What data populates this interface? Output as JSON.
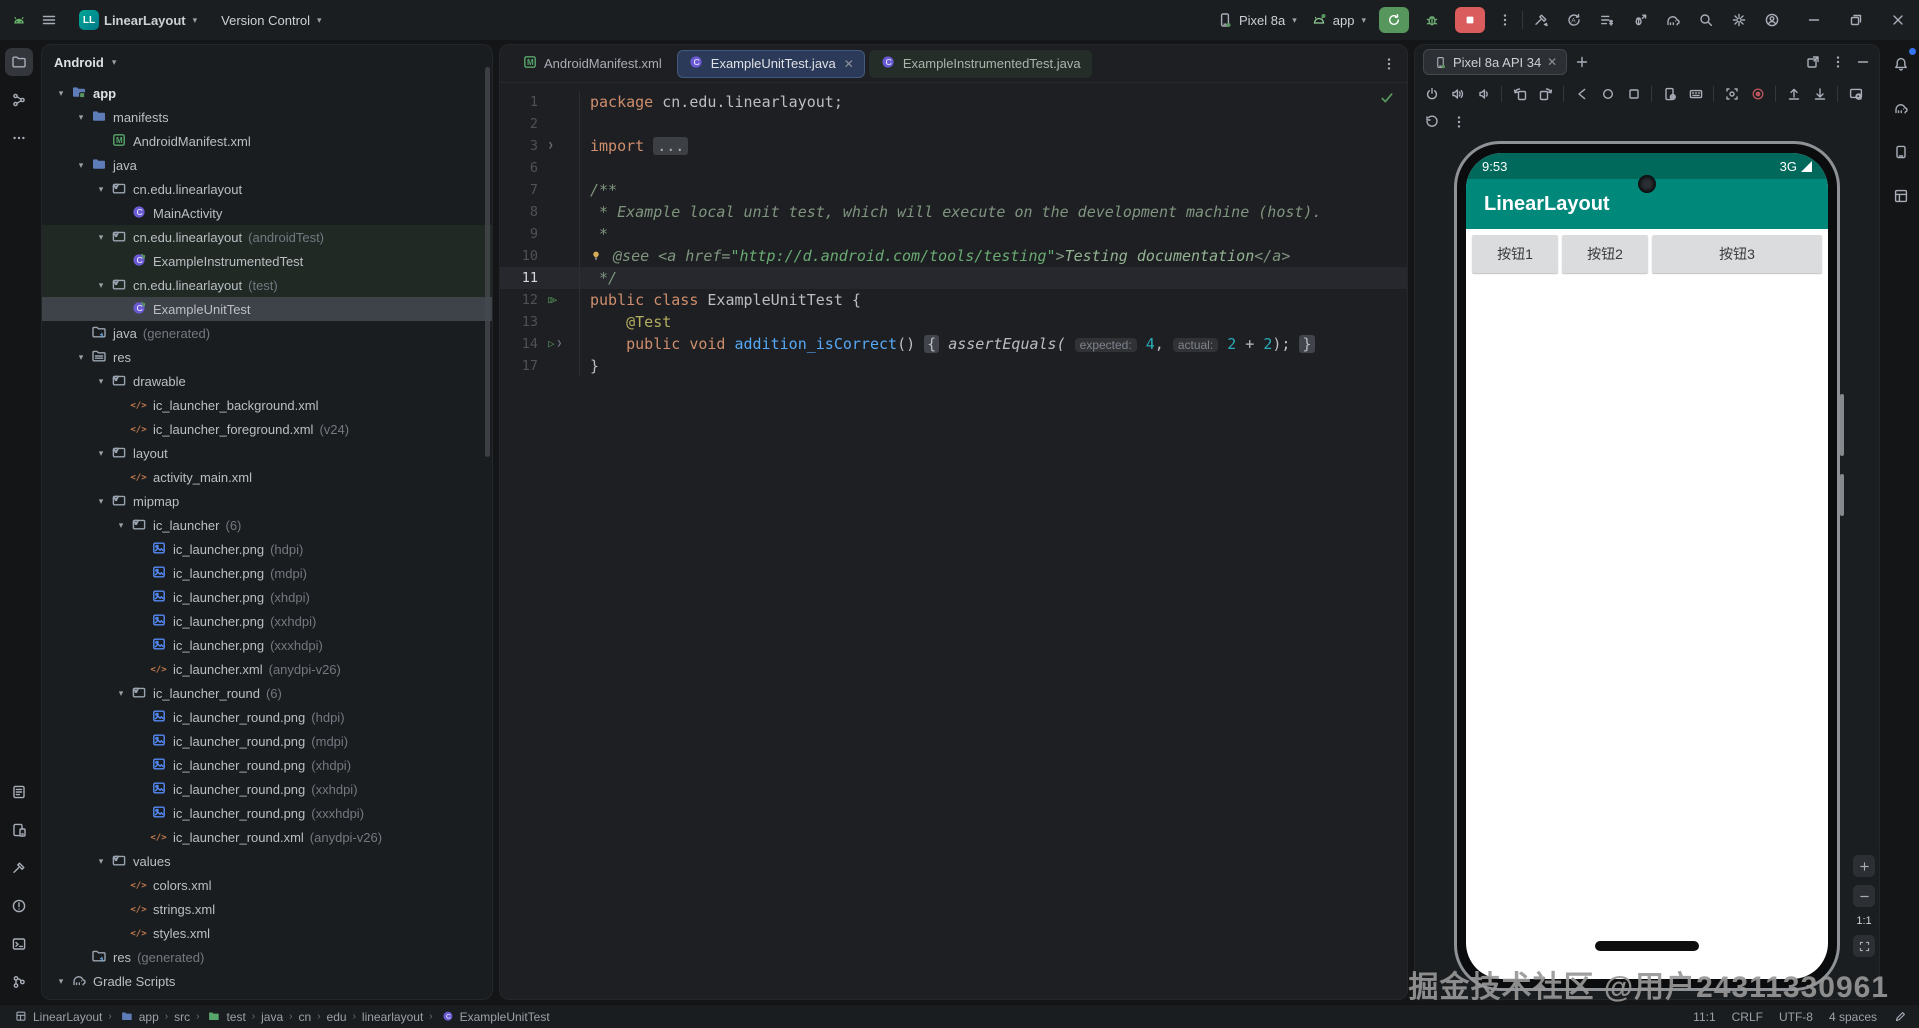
{
  "titlebar": {
    "project_badge": "LL",
    "project_name": "LinearLayout",
    "vcs_label": "Version Control",
    "device_name": "Pixel 8a",
    "run_config": "app",
    "left_icons": [
      "android-logo",
      "hamburger"
    ],
    "right_icons": [
      "build-hammer",
      "sync-a",
      "profiler-list",
      "attach-debug",
      "gradle-sync",
      "search",
      "settings",
      "account"
    ]
  },
  "left_strip": {
    "top": [
      "project",
      "structure",
      "more"
    ],
    "bottom": [
      "logcat",
      "device-manager",
      "build",
      "problems",
      "terminal",
      "version-control"
    ]
  },
  "project_panel": {
    "header": "Android",
    "tree": [
      {
        "i": 0,
        "ic": "folder-app",
        "t": "app",
        "m": "",
        "ch": 1,
        "b": 1
      },
      {
        "i": 1,
        "ic": "folder",
        "t": "manifests",
        "ch": 1
      },
      {
        "i": 2,
        "ic": "manifest",
        "t": "AndroidManifest.xml"
      },
      {
        "i": 1,
        "ic": "folder",
        "t": "java",
        "ch": 1
      },
      {
        "i": 2,
        "ic": "package",
        "t": "cn.edu.linearlayout",
        "ch": 1
      },
      {
        "i": 3,
        "ic": "class",
        "t": "MainActivity"
      },
      {
        "i": 2,
        "ic": "package",
        "t": "cn.edu.linearlayout",
        "m": "(androidTest)",
        "ch": 1,
        "tint": 1
      },
      {
        "i": 3,
        "ic": "testclass",
        "t": "ExampleInstrumentedTest",
        "tint": 1
      },
      {
        "i": 2,
        "ic": "package",
        "t": "cn.edu.linearlayout",
        "m": "(test)",
        "ch": 1,
        "tint": 1
      },
      {
        "i": 3,
        "ic": "testclass",
        "t": "ExampleUnitTest",
        "tint": 1,
        "sel": 1
      },
      {
        "i": 1,
        "ic": "folder-gen",
        "t": "java",
        "m": "(generated)"
      },
      {
        "i": 1,
        "ic": "folder-res",
        "t": "res",
        "ch": 1
      },
      {
        "i": 2,
        "ic": "package",
        "t": "drawable",
        "ch": 1
      },
      {
        "i": 3,
        "ic": "xml",
        "t": "ic_launcher_background.xml"
      },
      {
        "i": 3,
        "ic": "xml",
        "t": "ic_launcher_foreground.xml",
        "m": "(v24)"
      },
      {
        "i": 2,
        "ic": "package",
        "t": "layout",
        "ch": 1
      },
      {
        "i": 3,
        "ic": "xml",
        "t": "activity_main.xml"
      },
      {
        "i": 2,
        "ic": "package",
        "t": "mipmap",
        "ch": 1
      },
      {
        "i": 3,
        "ic": "package",
        "t": "ic_launcher",
        "m": "(6)",
        "ch": 1
      },
      {
        "i": 4,
        "ic": "image",
        "t": "ic_launcher.png",
        "m": "(hdpi)"
      },
      {
        "i": 4,
        "ic": "image",
        "t": "ic_launcher.png",
        "m": "(mdpi)"
      },
      {
        "i": 4,
        "ic": "image",
        "t": "ic_launcher.png",
        "m": "(xhdpi)"
      },
      {
        "i": 4,
        "ic": "image",
        "t": "ic_launcher.png",
        "m": "(xxhdpi)"
      },
      {
        "i": 4,
        "ic": "image",
        "t": "ic_launcher.png",
        "m": "(xxxhdpi)"
      },
      {
        "i": 4,
        "ic": "xml",
        "t": "ic_launcher.xml",
        "m": "(anydpi-v26)"
      },
      {
        "i": 3,
        "ic": "package",
        "t": "ic_launcher_round",
        "m": "(6)",
        "ch": 1
      },
      {
        "i": 4,
        "ic": "image",
        "t": "ic_launcher_round.png",
        "m": "(hdpi)"
      },
      {
        "i": 4,
        "ic": "image",
        "t": "ic_launcher_round.png",
        "m": "(mdpi)"
      },
      {
        "i": 4,
        "ic": "image",
        "t": "ic_launcher_round.png",
        "m": "(xhdpi)"
      },
      {
        "i": 4,
        "ic": "image",
        "t": "ic_launcher_round.png",
        "m": "(xxhdpi)"
      },
      {
        "i": 4,
        "ic": "image",
        "t": "ic_launcher_round.png",
        "m": "(xxxhdpi)"
      },
      {
        "i": 4,
        "ic": "xml",
        "t": "ic_launcher_round.xml",
        "m": "(anydpi-v26)"
      },
      {
        "i": 2,
        "ic": "package",
        "t": "values",
        "ch": 1
      },
      {
        "i": 3,
        "ic": "xml",
        "t": "colors.xml"
      },
      {
        "i": 3,
        "ic": "xml",
        "t": "strings.xml"
      },
      {
        "i": 3,
        "ic": "xml",
        "t": "styles.xml"
      },
      {
        "i": 1,
        "ic": "folder-gen",
        "t": "res",
        "m": "(generated)"
      },
      {
        "i": 0,
        "ic": "gradle",
        "t": "Gradle Scripts",
        "ch": 1
      }
    ]
  },
  "editor": {
    "tabs": [
      {
        "label": "AndroidManifest.xml",
        "icon": "manifest",
        "active": 0,
        "closable": 0,
        "tint": 0
      },
      {
        "label": "ExampleUnitTest.java",
        "icon": "class",
        "active": 1,
        "closable": 1,
        "tint": 0
      },
      {
        "label": "ExampleInstrumentedTest.java",
        "icon": "class",
        "active": 0,
        "closable": 0,
        "tint": 1
      }
    ],
    "lines": [
      {
        "n": "1",
        "tk": [
          [
            "kw",
            "package"
          ],
          [
            "pl",
            " cn.edu.linearlayout;"
          ]
        ]
      },
      {
        "n": "2",
        "tk": []
      },
      {
        "n": "3",
        "g": [
          "fold"
        ],
        "tk": [
          [
            "kw",
            "import"
          ],
          [
            "pl",
            " "
          ],
          [
            "fold",
            "..."
          ]
        ]
      },
      {
        "n": "6",
        "tk": []
      },
      {
        "n": "7",
        "tk": [
          [
            "cm",
            "/**"
          ]
        ]
      },
      {
        "n": "8",
        "tk": [
          [
            "cm",
            " * Example local unit test, which will execute on the development machine (host)."
          ]
        ]
      },
      {
        "n": "9",
        "tk": [
          [
            "cm",
            " *"
          ]
        ]
      },
      {
        "n": "10",
        "tk": [
          [
            "bulb",
            ""
          ],
          [
            "cm",
            " @see <a href="
          ],
          [
            "cms",
            "\"http://d.android.com/tools/testing\""
          ],
          [
            "cm",
            ">"
          ],
          [
            "cml",
            "Testing documentation"
          ],
          [
            "cm",
            "</a>"
          ]
        ]
      },
      {
        "n": "11",
        "caret": 1,
        "tk": [
          [
            "cm",
            " */"
          ]
        ]
      },
      {
        "n": "12",
        "g": [
          "run2"
        ],
        "tk": [
          [
            "kw",
            "public class"
          ],
          [
            "pl",
            " ExampleUnitTest {"
          ]
        ]
      },
      {
        "n": "13",
        "tk": [
          [
            "pl",
            "    "
          ],
          [
            "an",
            "@Test"
          ]
        ]
      },
      {
        "n": "14",
        "g": [
          "run",
          "fold"
        ],
        "tk": [
          [
            "pl",
            "    "
          ],
          [
            "kw",
            "public void"
          ],
          [
            "pl",
            " "
          ],
          [
            "mt",
            "addition_isCorrect"
          ],
          [
            "pl",
            "() "
          ],
          [
            "brace",
            "{"
          ],
          [
            "pl",
            " "
          ],
          [
            "it",
            "assertEquals("
          ],
          [
            "pl",
            " "
          ],
          [
            "hint",
            "expected:"
          ],
          [
            "pl",
            " "
          ],
          [
            "num",
            "4"
          ],
          [
            "pl",
            ", "
          ],
          [
            "hint",
            "actual:"
          ],
          [
            "pl",
            " "
          ],
          [
            "num",
            "2"
          ],
          [
            "pl",
            " + "
          ],
          [
            "num",
            "2"
          ],
          [
            "pl",
            "); "
          ],
          [
            "brace",
            "}"
          ]
        ]
      },
      {
        "n": "17",
        "tk": [
          [
            "pl",
            "}"
          ]
        ]
      }
    ]
  },
  "device_panel": {
    "tab_label": "Pixel 8a API 34",
    "header_icons": [
      "open-in-window",
      "kebab",
      "minimize"
    ],
    "toolbar_row1": [
      "power",
      "volume-up",
      "volume-down",
      "sep",
      "rotate-left",
      "rotate-right",
      "sep",
      "back",
      "home",
      "overview",
      "sep",
      "device-settings",
      "keyboard",
      "sep",
      "screenshot",
      "record",
      "sep",
      "upload",
      "download",
      "sep",
      "screen-search"
    ],
    "toolbar_row2": [
      "reset",
      "kebab"
    ],
    "zoom_label": "1:1",
    "phone": {
      "time": "9:53",
      "network": "3G",
      "app_title": "LinearLayout",
      "buttons": [
        "按钮1",
        "按钮2",
        "按钮3"
      ]
    }
  },
  "right_strip": [
    "notifications",
    "gradle-sync",
    "device-explorer",
    "layout-inspector"
  ],
  "status_bar": {
    "breadcrumbs": [
      {
        "icon": "module",
        "label": "LinearLayout"
      },
      {
        "icon": "folder",
        "label": "app"
      },
      {
        "icon": "",
        "label": "src"
      },
      {
        "icon": "folder-test",
        "label": "test"
      },
      {
        "icon": "",
        "label": "java"
      },
      {
        "icon": "",
        "label": "cn"
      },
      {
        "icon": "",
        "label": "edu"
      },
      {
        "icon": "",
        "label": "linearlayout"
      },
      {
        "icon": "class",
        "label": "ExampleUnitTest"
      }
    ],
    "caret_position": "11:1",
    "line_ending": "CRLF",
    "encoding": "UTF-8",
    "indent": "4 spaces"
  },
  "watermark": "掘金技术社区 @用户24311330961",
  "colors": {
    "accent": "#3574F0",
    "run_green": "#57965C",
    "stop_red": "#DB5C5C",
    "phone_statusbar_teal": "#00695C",
    "phone_appbar_teal": "#00897B"
  }
}
